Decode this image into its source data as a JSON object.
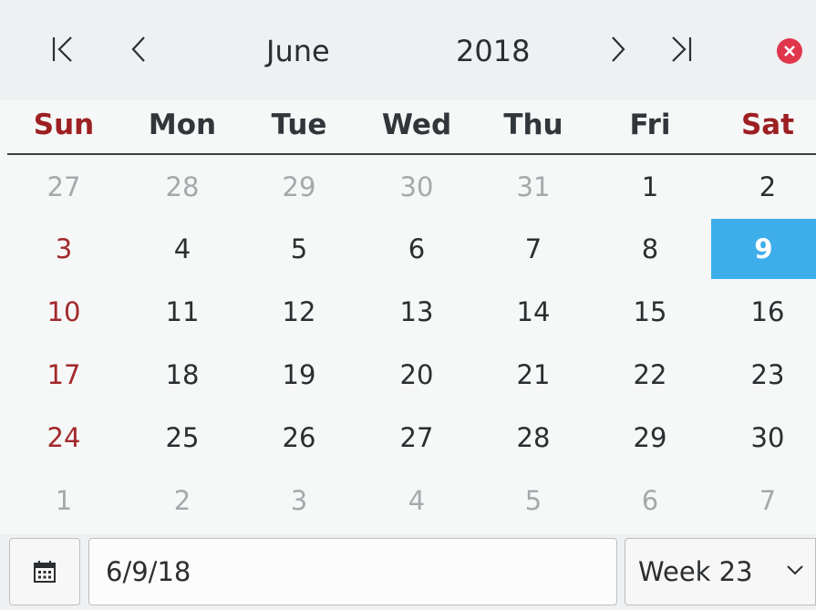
{
  "header": {
    "month": "June",
    "year": "2018"
  },
  "weekdays": [
    "Sun",
    "Mon",
    "Tue",
    "Wed",
    "Thu",
    "Fri",
    "Sat"
  ],
  "weeks": [
    [
      "27",
      "28",
      "29",
      "30",
      "31",
      "1",
      "2"
    ],
    [
      "3",
      "4",
      "5",
      "6",
      "7",
      "8",
      "9"
    ],
    [
      "10",
      "11",
      "12",
      "13",
      "14",
      "15",
      "16"
    ],
    [
      "17",
      "18",
      "19",
      "20",
      "21",
      "22",
      "23"
    ],
    [
      "24",
      "25",
      "26",
      "27",
      "28",
      "29",
      "30"
    ],
    [
      "1",
      "2",
      "3",
      "4",
      "5",
      "6",
      "7"
    ]
  ],
  "muted": [
    [
      true,
      true,
      true,
      true,
      true,
      false,
      false
    ],
    [
      false,
      false,
      false,
      false,
      false,
      false,
      false
    ],
    [
      false,
      false,
      false,
      false,
      false,
      false,
      false
    ],
    [
      false,
      false,
      false,
      false,
      false,
      false,
      false
    ],
    [
      false,
      false,
      false,
      false,
      false,
      false,
      false
    ],
    [
      true,
      true,
      true,
      true,
      true,
      true,
      true
    ]
  ],
  "selected": {
    "week": 1,
    "day": 6
  },
  "footer": {
    "date_value": "6/9/18",
    "week_label": "Week 23"
  },
  "colors": {
    "accent": "#3daee9",
    "weekend": "#9d1f22",
    "close": "#e0364c"
  },
  "icons": {
    "first": "first-month-icon",
    "prev": "previous-month-icon",
    "next": "next-month-icon",
    "last": "last-month-icon",
    "close": "close-icon",
    "calendar": "calendar-icon",
    "dropdown": "chevron-down-icon"
  }
}
